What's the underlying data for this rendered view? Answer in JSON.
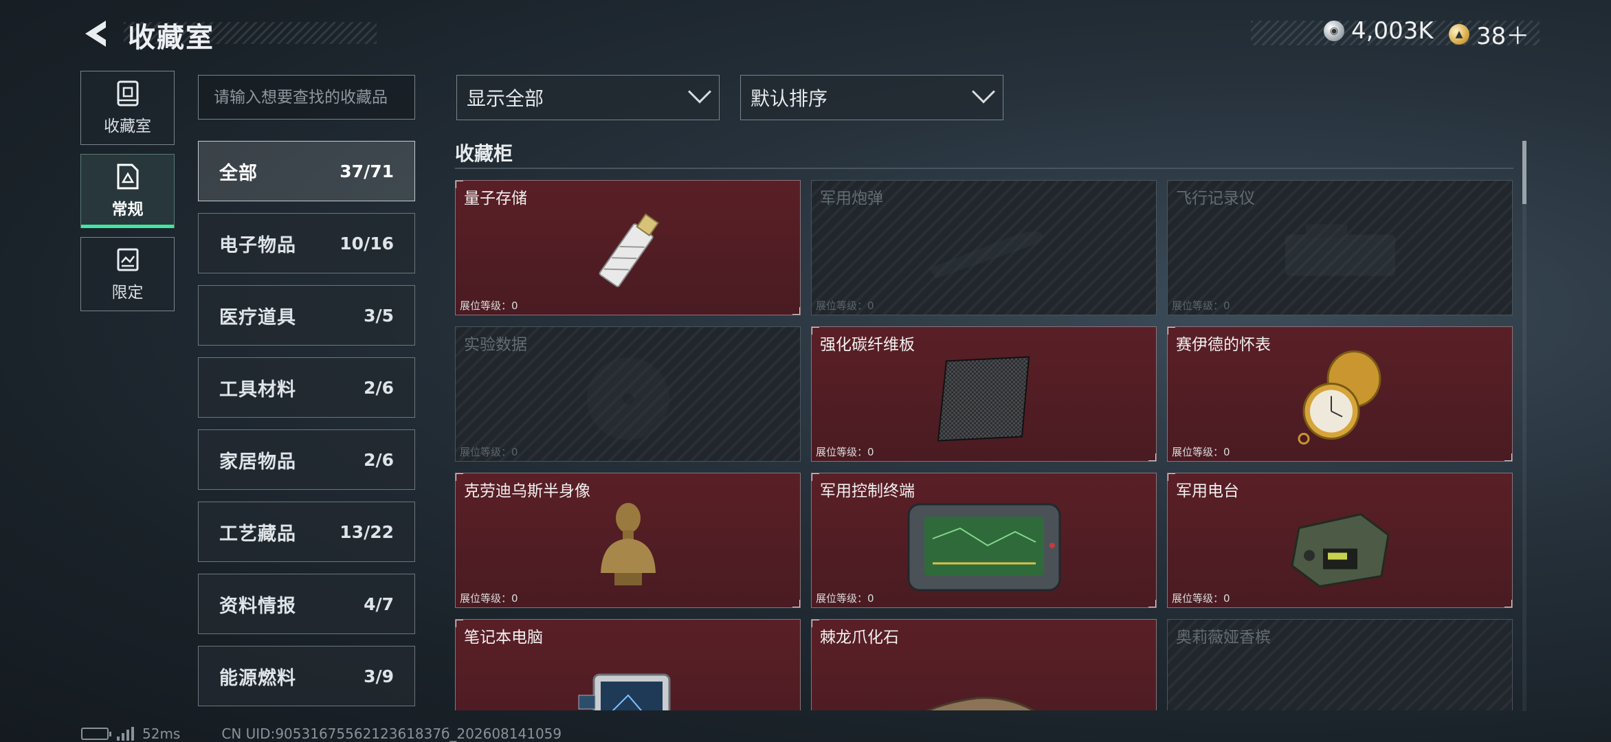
{
  "header": {
    "title": "收藏室",
    "currencies": [
      {
        "icon": "silver-coin-icon",
        "value": "4,003K"
      },
      {
        "icon": "gold-coin-icon",
        "value": "38＋"
      }
    ]
  },
  "nav": [
    {
      "label": "收藏室",
      "icon": "collection-room-icon",
      "active": false
    },
    {
      "label": "常规",
      "icon": "regular-icon",
      "active": true
    },
    {
      "label": "限定",
      "icon": "limited-icon",
      "active": false
    }
  ],
  "search": {
    "placeholder": "请输入想要查找的收藏品"
  },
  "categories": [
    {
      "name": "全部",
      "count": "37/71",
      "active": true
    },
    {
      "name": "电子物品",
      "count": "10/16"
    },
    {
      "name": "医疗道具",
      "count": "3/5"
    },
    {
      "name": "工具材料",
      "count": "2/6"
    },
    {
      "name": "家居物品",
      "count": "2/6"
    },
    {
      "name": "工艺藏品",
      "count": "13/22"
    },
    {
      "name": "资料情报",
      "count": "4/7"
    },
    {
      "name": "能源燃料",
      "count": "3/9"
    }
  ],
  "filters": {
    "show": "显示全部",
    "sort": "默认排序"
  },
  "cabinet": {
    "title": "收藏柜",
    "level_label": "展位等级：0",
    "items": [
      {
        "name": "量子存储",
        "owned": true,
        "icon": "usb-drive-icon"
      },
      {
        "name": "军用炮弹",
        "owned": false,
        "icon": "shell-icon"
      },
      {
        "name": "飞行记录仪",
        "owned": false,
        "icon": "flight-recorder-icon"
      },
      {
        "name": "实验数据",
        "owned": false,
        "icon": "disc-icon"
      },
      {
        "name": "强化碳纤维板",
        "owned": true,
        "icon": "carbon-plate-icon"
      },
      {
        "name": "赛伊德的怀表",
        "owned": true,
        "icon": "pocket-watch-icon"
      },
      {
        "name": "克劳迪乌斯半身像",
        "owned": true,
        "icon": "bust-icon"
      },
      {
        "name": "军用控制终端",
        "owned": true,
        "icon": "terminal-icon"
      },
      {
        "name": "军用电台",
        "owned": true,
        "icon": "radio-icon"
      },
      {
        "name": "笔记本电脑",
        "owned": true,
        "icon": "laptop-icon"
      },
      {
        "name": "棘龙爪化石",
        "owned": true,
        "icon": "claw-fossil-icon"
      },
      {
        "name": "奥莉薇娅香槟",
        "owned": false,
        "icon": "champagne-icon"
      }
    ]
  },
  "footer": {
    "ping": "52ms",
    "uid": "CN UID:9053167556212361837б_202608141059"
  }
}
